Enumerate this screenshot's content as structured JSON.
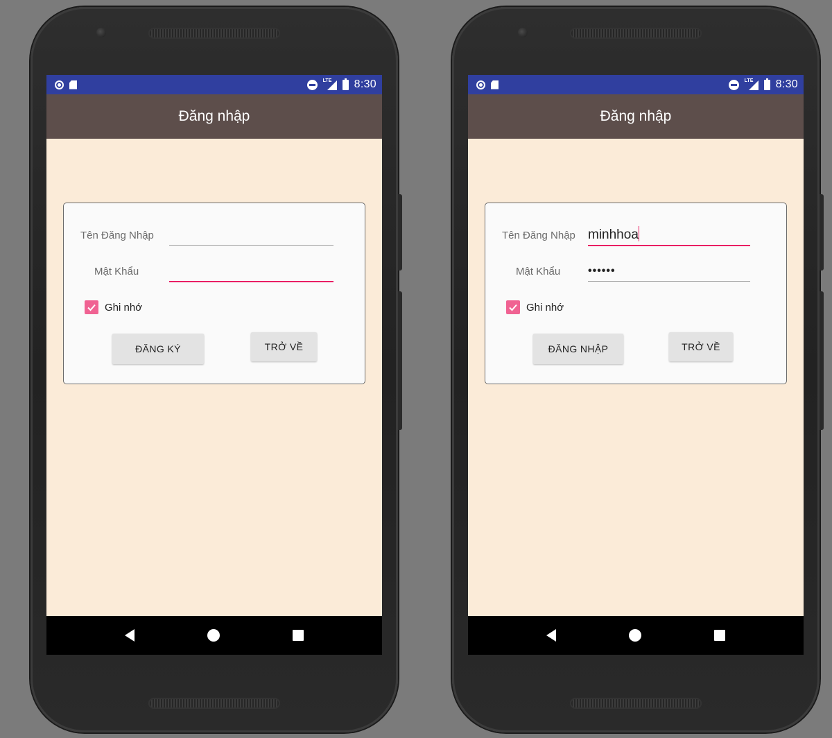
{
  "screens": [
    {
      "status_bar": {
        "time": "8:30",
        "network": "LTE"
      },
      "app_bar": {
        "title": "Đăng nhập"
      },
      "form": {
        "username_label": "Tên Đăng Nhập",
        "username_value": "",
        "password_label": "Mật Khẩu",
        "password_value": "",
        "remember_label": "Ghi nhớ",
        "remember_checked": true,
        "primary_button": "ĐĂNG KÝ",
        "back_button": "TRỞ VỀ"
      }
    },
    {
      "status_bar": {
        "time": "8:30",
        "network": "LTE"
      },
      "app_bar": {
        "title": "Đăng nhập"
      },
      "form": {
        "username_label": "Tên Đăng Nhập",
        "username_value": "minhhoa",
        "password_label": "Mật Khẩu",
        "password_value": "••••••",
        "remember_label": "Ghi nhớ",
        "remember_checked": true,
        "primary_button": "ĐĂNG NHẬP",
        "back_button": "TRỞ VỀ"
      }
    }
  ],
  "colors": {
    "status_bar": "#303f9f",
    "app_bar": "#5d4e4b",
    "screen_background": "#fbebd8",
    "accent": "#e91e63",
    "checkbox": "#f06292"
  },
  "icons": [
    "notification-circle-icon",
    "sd-card-icon",
    "do-not-disturb-icon",
    "lte-signal-icon",
    "battery-charging-icon",
    "nav-back-icon",
    "nav-home-icon",
    "nav-recents-icon",
    "checkmark-icon"
  ]
}
